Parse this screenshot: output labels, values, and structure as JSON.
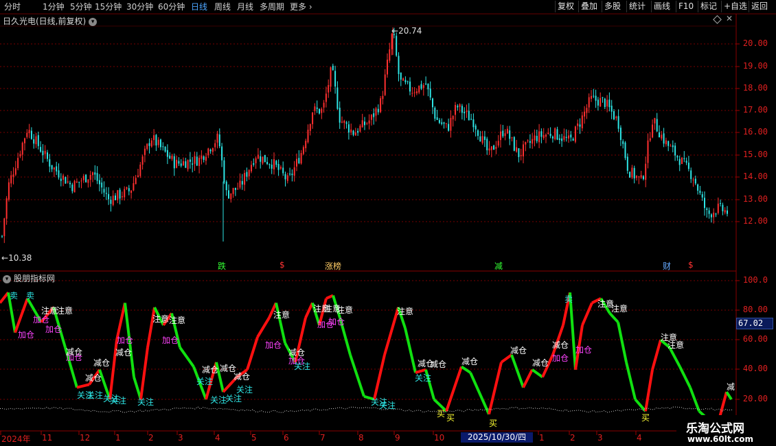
{
  "toolbar": {
    "periods": [
      "分时",
      "1分钟",
      "5分钟",
      "15分钟",
      "30分钟",
      "60分钟",
      "日线",
      "周线",
      "月线",
      "多周期",
      "更多"
    ],
    "active": "日线",
    "right_buttons": [
      "复权",
      "叠加",
      "多股",
      "统计",
      "画线",
      "F10",
      "标记",
      "+自选",
      "返回"
    ]
  },
  "main_panel": {
    "title": "日久光电(日线,前复权)",
    "high_label": "20.74",
    "low_label": "10.38",
    "yticks": [
      "20.00",
      "19.00",
      "18.00",
      "17.00",
      "16.00",
      "15.00",
      "14.00",
      "13.00",
      "12.00"
    ]
  },
  "indicator_panel": {
    "title": "股朋指标网",
    "yticks": [
      "100.0",
      "80.00",
      "60.00",
      "40.00",
      "20.00"
    ],
    "current_value": "67.02"
  },
  "x_axis": {
    "labels": [
      "2024年",
      "11",
      "12",
      "1",
      "2",
      "3",
      "4",
      "5",
      "6",
      "7",
      "8",
      "9",
      "10",
      "2025/10/30/四",
      "1",
      "2",
      "3",
      "4"
    ]
  },
  "events": [
    "跌",
    "$",
    "涨榜",
    "减",
    "财",
    "$"
  ],
  "signal_labels": [
    "卖",
    "卖",
    "注意",
    "注意",
    "注意",
    "注意",
    "注意",
    "注意",
    "注意",
    "注意",
    "注意",
    "注意",
    "注意",
    "注意",
    "注意",
    "加仓",
    "加仓",
    "加仓",
    "加仓",
    "加仓",
    "加仓",
    "加仓",
    "加仓",
    "加仓",
    "加仓",
    "加仓",
    "加仓",
    "减仓",
    "减仓",
    "减仓",
    "减仓",
    "减仓",
    "减仓",
    "减仓",
    "减仓",
    "减仓",
    "减仓",
    "减仓",
    "减仓",
    "减仓",
    "减仓",
    "关注",
    "关注",
    "关注",
    "关注",
    "关注",
    "关注",
    "关注",
    "关注",
    "关注",
    "关注",
    "关注",
    "关注",
    "关注",
    "买",
    "买",
    "买",
    "买",
    "卖",
    "减"
  ],
  "brand": {
    "name": "乐淘公式网",
    "url": "www.60lt.com"
  },
  "colors": {
    "up": "#ff3030",
    "down": "#2ee6e6",
    "indicator_up": "#ff1010",
    "indicator_down": "#10e010",
    "grid": "#7a0000",
    "axis_text": "#e02020"
  }
}
